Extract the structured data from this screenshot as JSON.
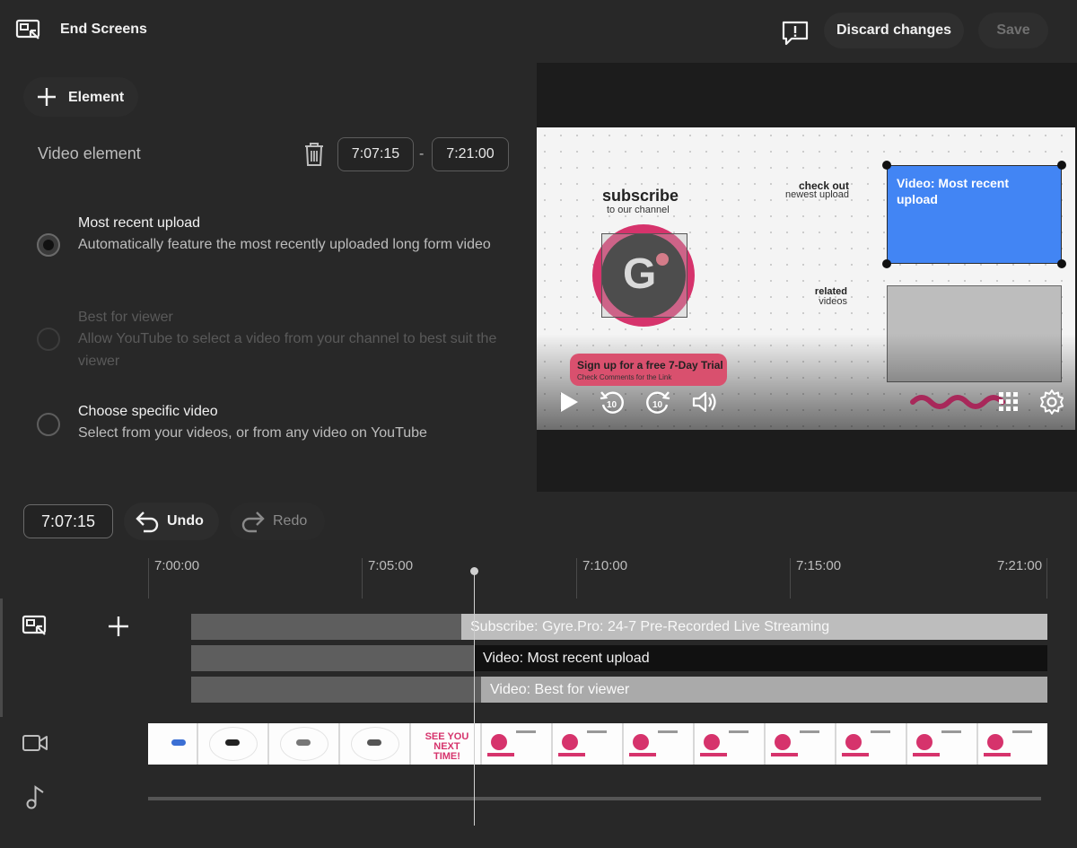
{
  "topbar": {
    "title": "End Screens",
    "discard_label": "Discard changes",
    "save_label": "Save"
  },
  "left_panel": {
    "element_button_label": "Element",
    "section_title": "Video element",
    "start_time": "7:07:15",
    "separator": "-",
    "end_time": "7:21:00",
    "options": [
      {
        "title": "Most recent upload",
        "description": "Automatically feature the most recently uploaded long form video",
        "selected": true,
        "disabled": false
      },
      {
        "title": "Best for viewer",
        "description": "Allow YouTube to select a video from your channel to best suit the viewer",
        "selected": false,
        "disabled": true
      },
      {
        "title": "Choose specific video",
        "description": "Select from your videos, or from any video on YouTube",
        "selected": false,
        "disabled": false
      }
    ]
  },
  "preview": {
    "subscribe_title": "subscribe",
    "subscribe_sub": "to our channel",
    "logo_letter": "G",
    "checkout_1": "check out",
    "checkout_2": "newest upload",
    "related_1": "related",
    "related_2": "videos",
    "video_element_label": "Video: Most recent upload",
    "promo_main": "Sign up for a free 7-Day Trial",
    "promo_sub": "Check Comments for the Link",
    "controls": [
      "play-icon",
      "rewind-10-icon",
      "forward-10-icon",
      "volume-icon",
      "grid-icon",
      "settings-icon"
    ]
  },
  "editor_toolbar": {
    "current_time": "7:07:15",
    "undo_label": "Undo",
    "redo_label": "Redo"
  },
  "timeline": {
    "ruler": [
      "7:00:00",
      "7:05:00",
      "7:10:00",
      "7:15:00",
      "7:21:00"
    ],
    "tracks": [
      {
        "label": "Subscribe: Gyre.Pro: 24-7 Pre-Recorded Live Streaming"
      },
      {
        "label": "Video: Most recent upload"
      },
      {
        "label": "Video: Best for viewer"
      }
    ],
    "thumb_text": "SEE YOU NEXT TIME!"
  },
  "colors": {
    "accent_blue": "#4285f4",
    "brand_pink": "#d6336c",
    "background": "#282828"
  }
}
